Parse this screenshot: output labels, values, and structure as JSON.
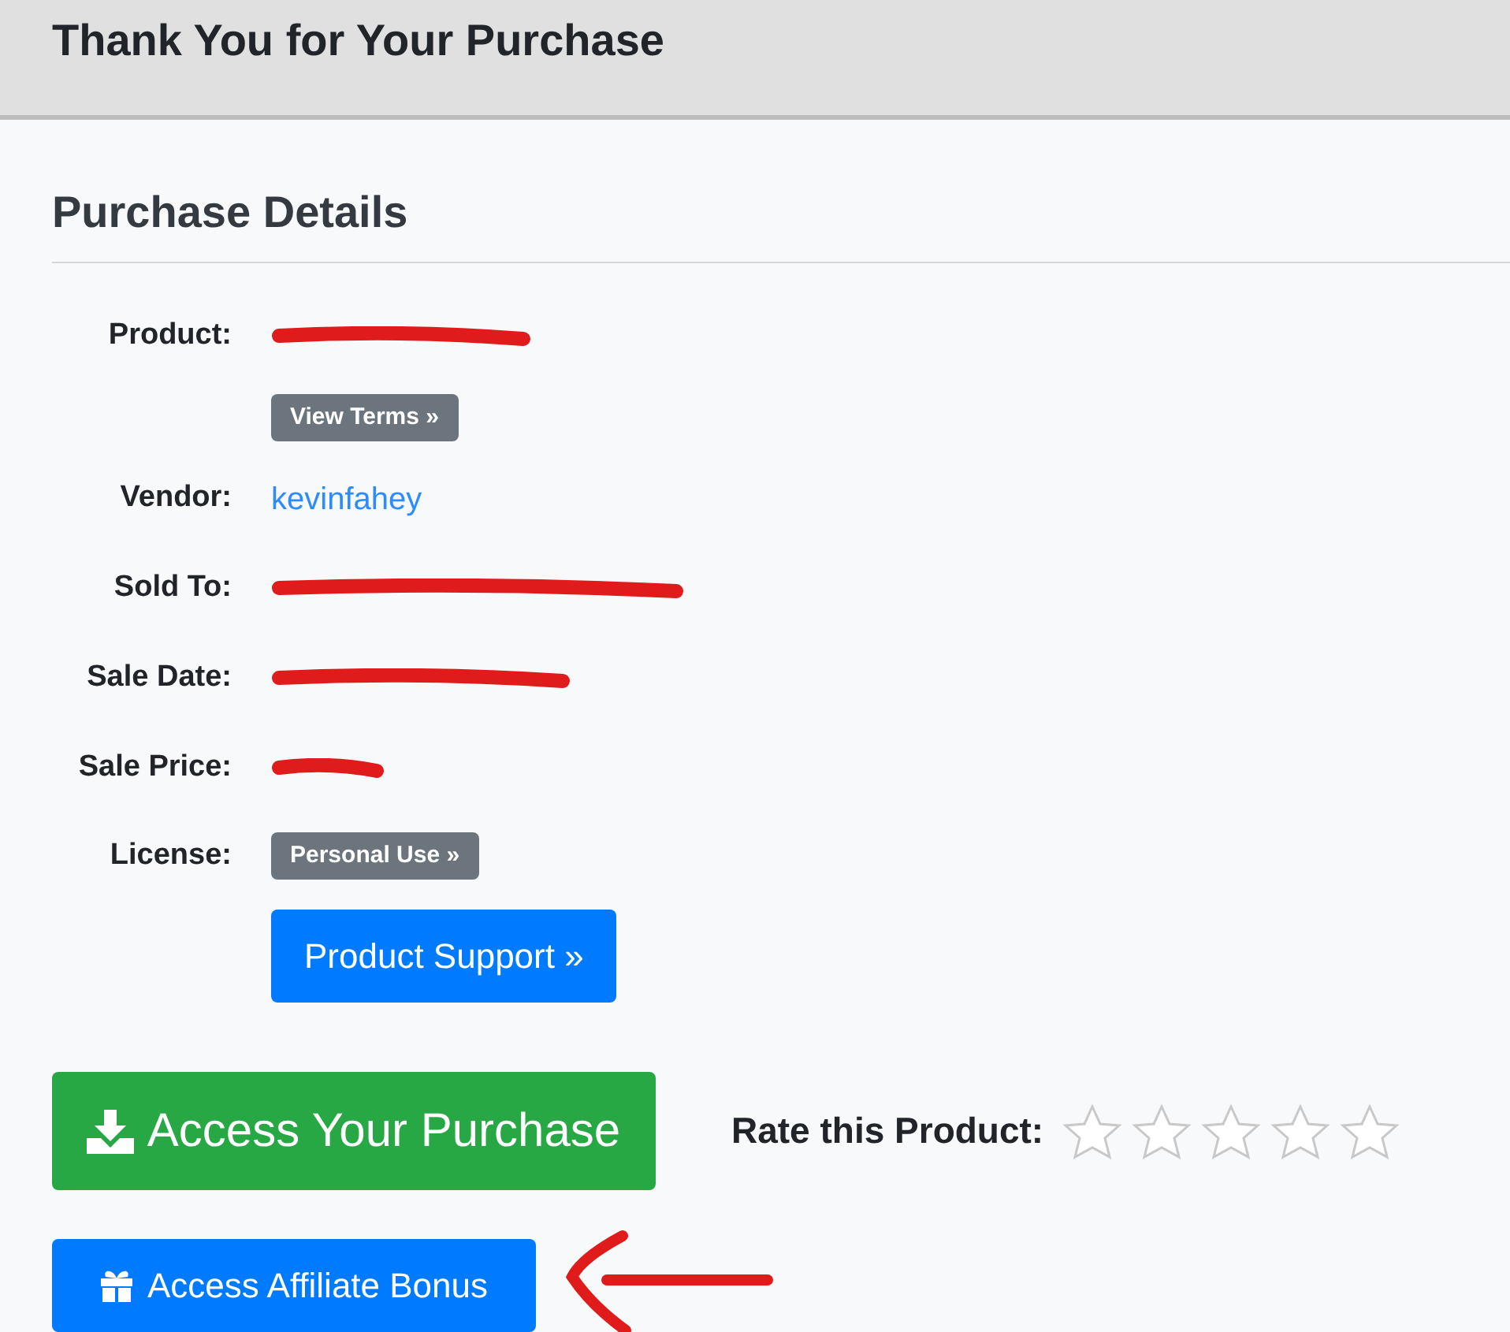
{
  "header": {
    "title": "Thank You for Your Purchase"
  },
  "section": {
    "title": "Purchase Details"
  },
  "details": [
    {
      "kind": "text",
      "label": "Product:",
      "redacted": true
    },
    {
      "kind": "badge",
      "badge": "View Terms »"
    },
    {
      "kind": "text",
      "label": "Vendor:",
      "value": "kevinfahey",
      "link": true,
      "redacted": false
    },
    {
      "kind": "text",
      "label": "Sold To:",
      "redacted": true
    },
    {
      "kind": "text",
      "label": "Sale Date:",
      "redacted": true
    },
    {
      "kind": "text",
      "label": "Sale Price:",
      "redacted": true
    },
    {
      "kind": "badge",
      "label": "License:",
      "badge": "Personal Use »"
    },
    {
      "kind": "button",
      "button": "Product Support »"
    }
  ],
  "access_button": "Access Your Purchase",
  "rating": {
    "label": "Rate this Product:",
    "stars": 0
  },
  "affiliate_button": "Access Affiliate Bonus",
  "annotation": {
    "arrow": true
  }
}
